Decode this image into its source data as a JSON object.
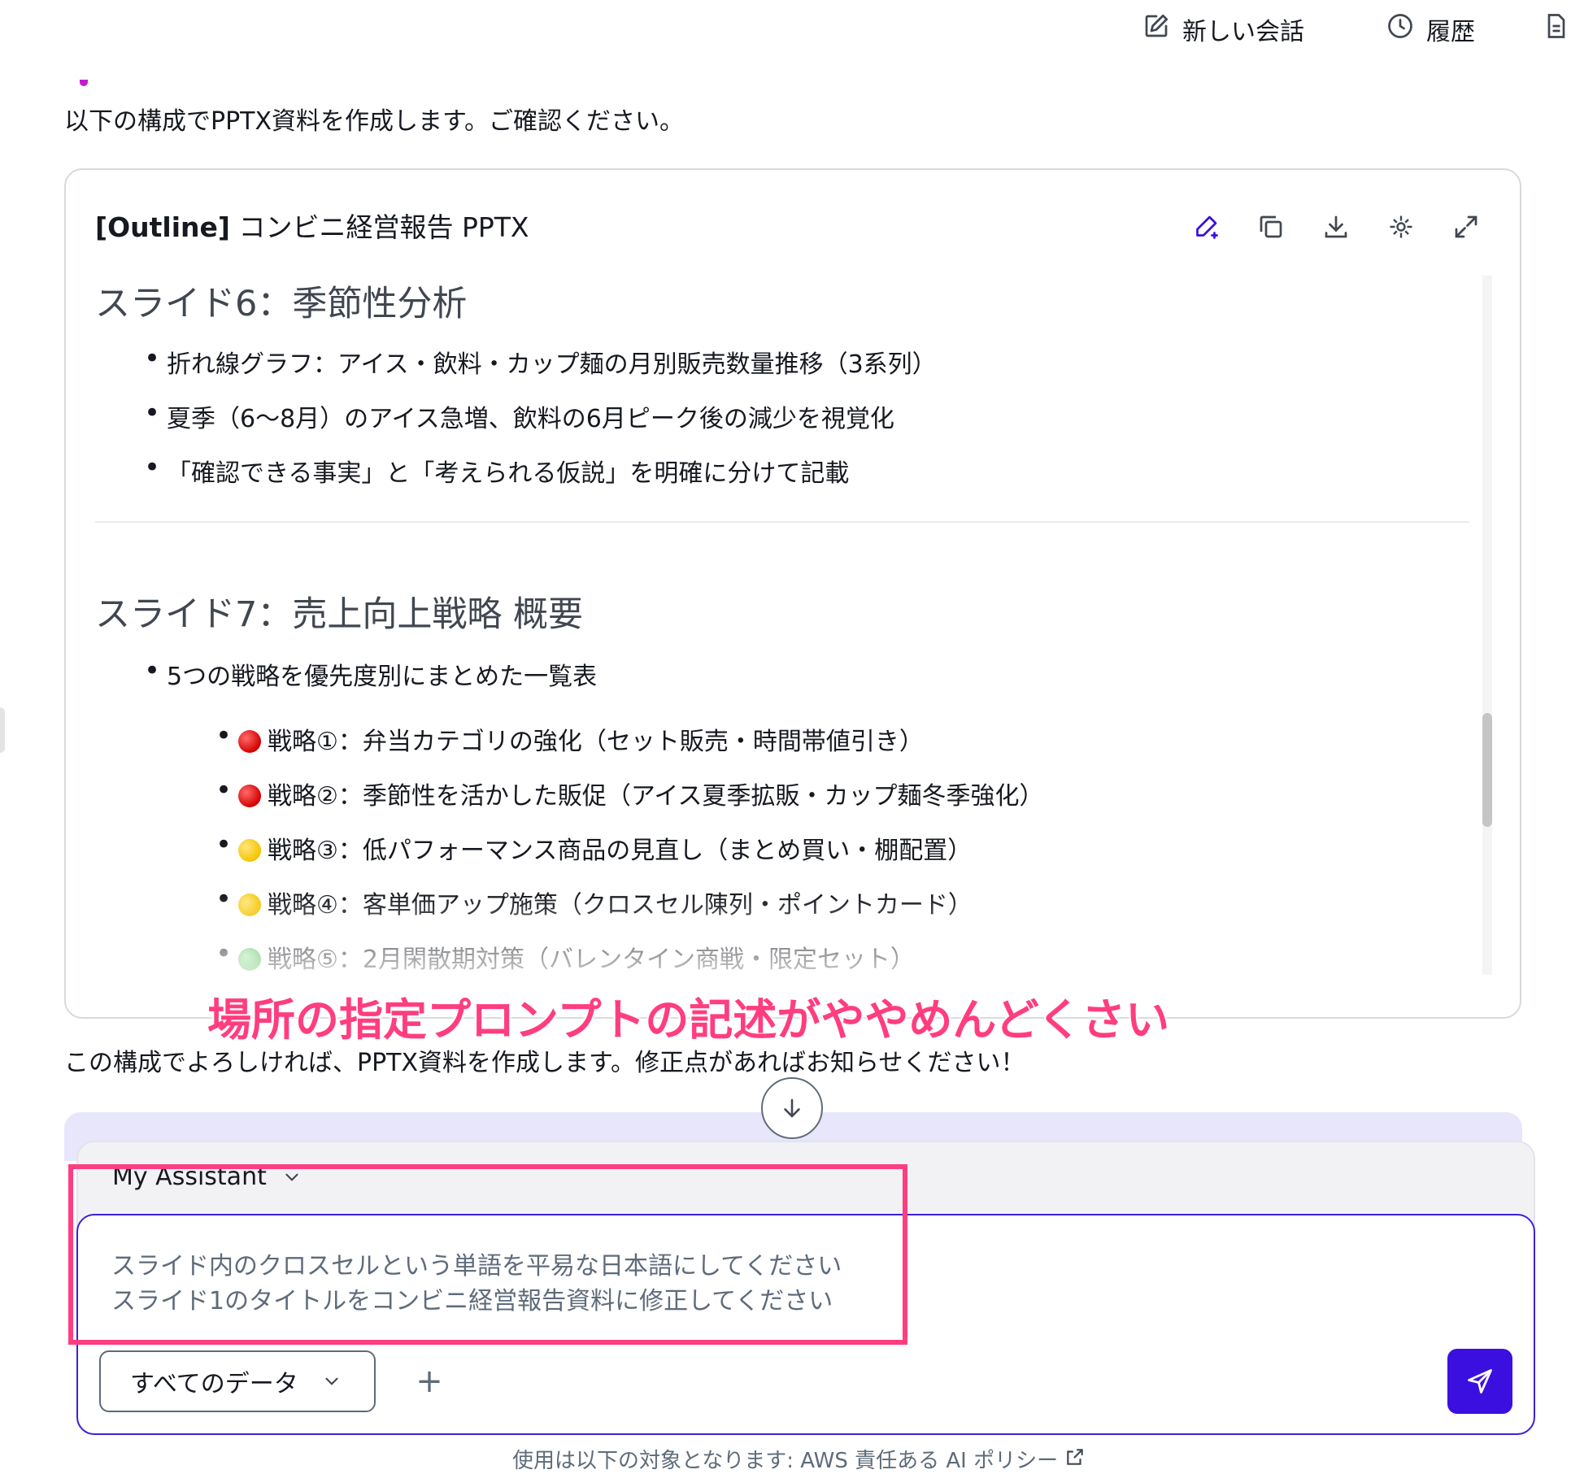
{
  "topbar": {
    "new_chat_label": "新しい会話",
    "history_label": "履歴"
  },
  "intro_text": "以下の構成でPPTX資料を作成します。ご確認ください。",
  "outline_card": {
    "title_prefix": "[Outline]",
    "title_text": " コンビニ経営報告 PPTX",
    "icons": [
      "edit-icon",
      "copy-icon",
      "download-icon",
      "ai-sparkle-icon",
      "expand-icon"
    ]
  },
  "slide6": {
    "heading": "スライド6：季節性分析",
    "bullets": [
      "折れ線グラフ：アイス・飲料・カップ麺の月別販売数量推移（3系列）",
      "夏季（6〜8月）のアイス急増、飲料の6月ピーク後の減少を視覚化",
      "「確認できる事実」と「考えられる仮説」を明確に分けて記載"
    ]
  },
  "slide7": {
    "heading": "スライド7：売上向上戦略 概要",
    "bullet": "5つの戦略を優先度別にまとめた一覧表",
    "strategies": [
      {
        "priority": "red",
        "text": "戦略①：弁当カテゴリの強化（セット販売・時間帯値引き）"
      },
      {
        "priority": "red",
        "text": "戦略②：季節性を活かした販促（アイス夏季拡販・カップ麺冬季強化）"
      },
      {
        "priority": "yellow",
        "text": "戦略③：低パフォーマンス商品の見直し（まとめ買い・棚配置）"
      },
      {
        "priority": "yellow",
        "text": "戦略④：客単価アップ施策（クロスセル陳列・ポイントカード）"
      },
      {
        "priority": "green",
        "text": "戦略⑤：2月閑散期対策（バレンタイン商戦・限定セット）"
      }
    ]
  },
  "annotation": "場所の指定プロンプトの記述がややめんどくさい",
  "confirm_text": "この構成でよろしければ、PPTX資料を作成します。修正点があればお知らせください！",
  "composer": {
    "assistant_label": "My Assistant",
    "input_lines": [
      "スライド内のクロスセルという単語を平易な日本語にしてください",
      "スライド1のタイトルをコンビニ経営報告資料に修正してください"
    ],
    "data_select_label": "すべてのデータ",
    "plus_label": "+"
  },
  "policy_text": "使用は以下の対象となります: AWS 責任ある AI ポリシー",
  "colors": {
    "accent": "#3b0fe0",
    "annotation": "#ff3d7f",
    "input_border": "#3b21d6"
  }
}
